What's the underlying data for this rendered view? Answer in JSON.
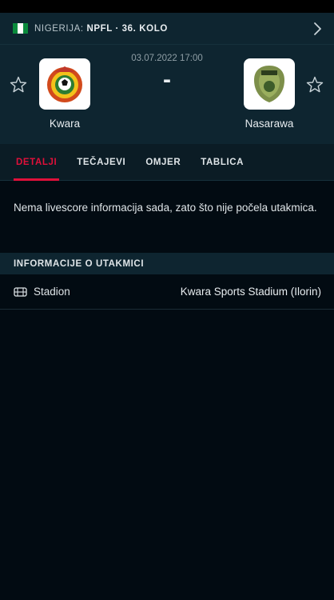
{
  "league": {
    "country": "NIGERIJA:",
    "competition": "NPFL · 36. KOLO",
    "flag_colors": [
      "#0a8a3c",
      "#ffffff",
      "#0a8a3c"
    ]
  },
  "match": {
    "kickoff": "03.07.2022 17:00",
    "score": "-",
    "home_team": "Kwara",
    "away_team": "Nasarawa"
  },
  "tabs": [
    {
      "label": "DETALJI",
      "active": true
    },
    {
      "label": "TEČAJEVI",
      "active": false
    },
    {
      "label": "OMJER",
      "active": false
    },
    {
      "label": "TABLICA",
      "active": false
    }
  ],
  "info_message": "Nema livescore informacija sada, zato što nije počela utakmica.",
  "match_info": {
    "header": "INFORMACIJE O UTAKMICI",
    "rows": [
      {
        "icon": "stadium-icon",
        "label": "Stadion",
        "value": "Kwara Sports Stadium (Ilorin)"
      }
    ]
  },
  "colors": {
    "accent": "#e0103a",
    "background": "#020b12",
    "header_bg": "#0e2530"
  }
}
